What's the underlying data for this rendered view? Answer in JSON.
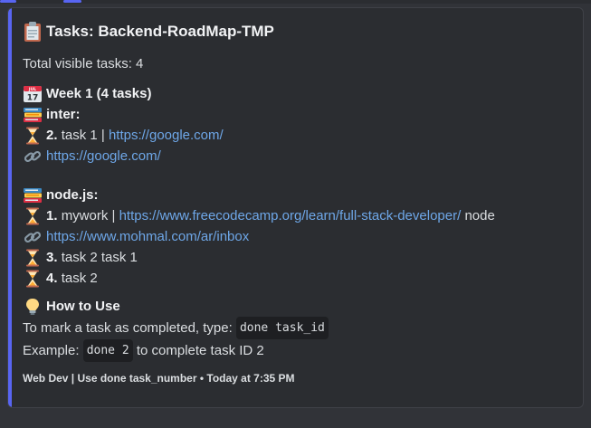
{
  "embed": {
    "accent": "#5865f2",
    "title": "Tasks: Backend-RoadMap-TMP",
    "total": "Total visible tasks: 4",
    "week": {
      "label": "Week 1 (4 tasks)",
      "calendar_day": "17",
      "calendar_month": "JUL"
    },
    "groups": [
      {
        "name": "inter:",
        "tasks": [
          {
            "num": "2.",
            "text": "task 1 |",
            "link": "https://google.com/",
            "after": ""
          }
        ],
        "link_line": "https://google.com/"
      },
      {
        "name": "node.js:",
        "tasks": [
          {
            "num": "1.",
            "text": "mywork |",
            "link": "https://www.freecodecamp.org/learn/full-stack-developer/",
            "after": "node"
          }
        ],
        "link_line": "https://www.mohmal.com/ar/inbox",
        "extra_tasks": [
          {
            "num": "3.",
            "text": "task 2 task 1"
          },
          {
            "num": "4.",
            "text": "task 2"
          }
        ]
      }
    ],
    "howto": {
      "title": "How to Use",
      "line1_text": "To mark a task as completed, type:",
      "line1_code": "done task_id",
      "line2_prefix": "Example:",
      "line2_code": "done 2",
      "line2_suffix": "to complete task ID 2"
    },
    "footer": "Web Dev | Use done task_number • Today at 7:35 PM"
  },
  "icons": {
    "title": "clipboard-icon",
    "week": "calendar-icon",
    "group": "books-icon",
    "task": "hourglass-icon",
    "link": "link-icon",
    "howto": "lightbulb-icon"
  }
}
